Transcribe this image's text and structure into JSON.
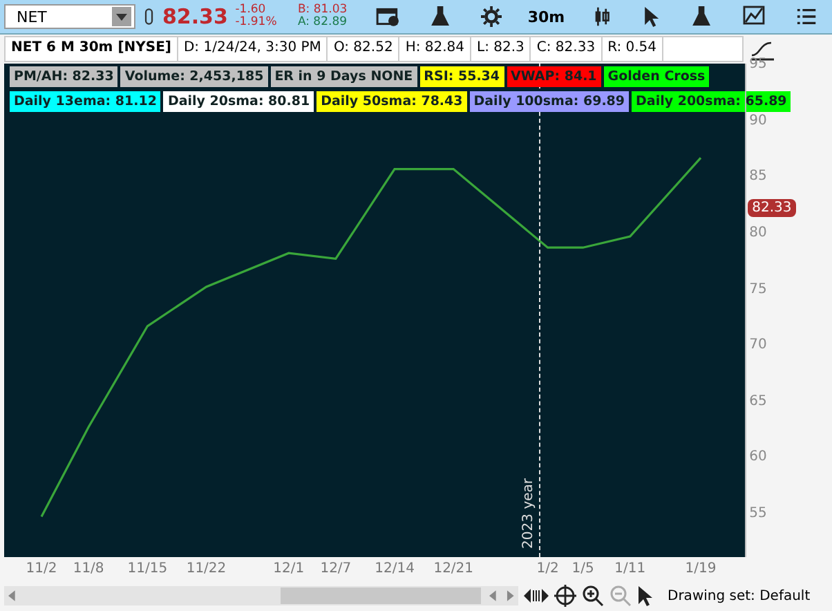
{
  "toolbar": {
    "symbol": "NET",
    "last": "82.33",
    "change": "-1.60",
    "change_pct": "-1.91%",
    "bid": "B: 81.03",
    "ask": "A: 82.89",
    "interval": "30m"
  },
  "info_bar": {
    "title": "NET 6 M 30m [NYSE]",
    "fields": [
      "D: 1/24/24, 3:30 PM",
      "O: 82.52",
      "H: 82.84",
      "L: 82.3",
      "C: 82.33",
      "R: 0.54"
    ]
  },
  "study_labels": [
    {
      "text": "PM/AH: 82.33",
      "color": "#c0c0c0"
    },
    {
      "text": "Volume: 2,453,185",
      "color": "#c0c0c0"
    },
    {
      "text": "ER in 9 Days NONE",
      "color": "#c0c0c0"
    },
    {
      "text": "RSI: 55.34",
      "color": "#ffff00"
    },
    {
      "text": "VWAP: 84.1",
      "color": "#ff0000"
    },
    {
      "text": "Golden Cross",
      "color": "#00ff00"
    }
  ],
  "ma_labels": [
    {
      "text": "Daily 13ema: 81.12",
      "color": "#00ffff"
    },
    {
      "text": "Daily 20sma: 80.81",
      "color": "#ffffff"
    },
    {
      "text": "Daily 50sma: 78.43",
      "color": "#ffff00"
    },
    {
      "text": "Daily 100sma: 69.89",
      "color": "#9999ff"
    },
    {
      "text": "Daily 200sma: 65.89",
      "color": "#00ff00"
    }
  ],
  "chart": {
    "price_tag": "82.33",
    "chart_data": {
      "type": "line",
      "categories": [
        "11/2",
        "11/8",
        "11/15",
        "11/22",
        "12/1",
        "12/7",
        "12/14",
        "12/21",
        "1/2",
        "1/5",
        "1/11",
        "1/19"
      ],
      "series": [
        {
          "color": "#3aa63a",
          "values": [
            55,
            63,
            72,
            75.5,
            78.5,
            78,
            86,
            86,
            79,
            79,
            80,
            87
          ]
        }
      ],
      "ylim": [
        51.4,
        95.4
      ],
      "yticks": [
        55,
        60,
        65,
        70,
        75,
        80,
        85,
        90,
        95
      ],
      "ref_lines": [
        {
          "axis": "x",
          "value": "1/2",
          "label": "2023 year"
        }
      ]
    }
  },
  "status_bar": {
    "drawing_set": "Drawing set: Default"
  }
}
